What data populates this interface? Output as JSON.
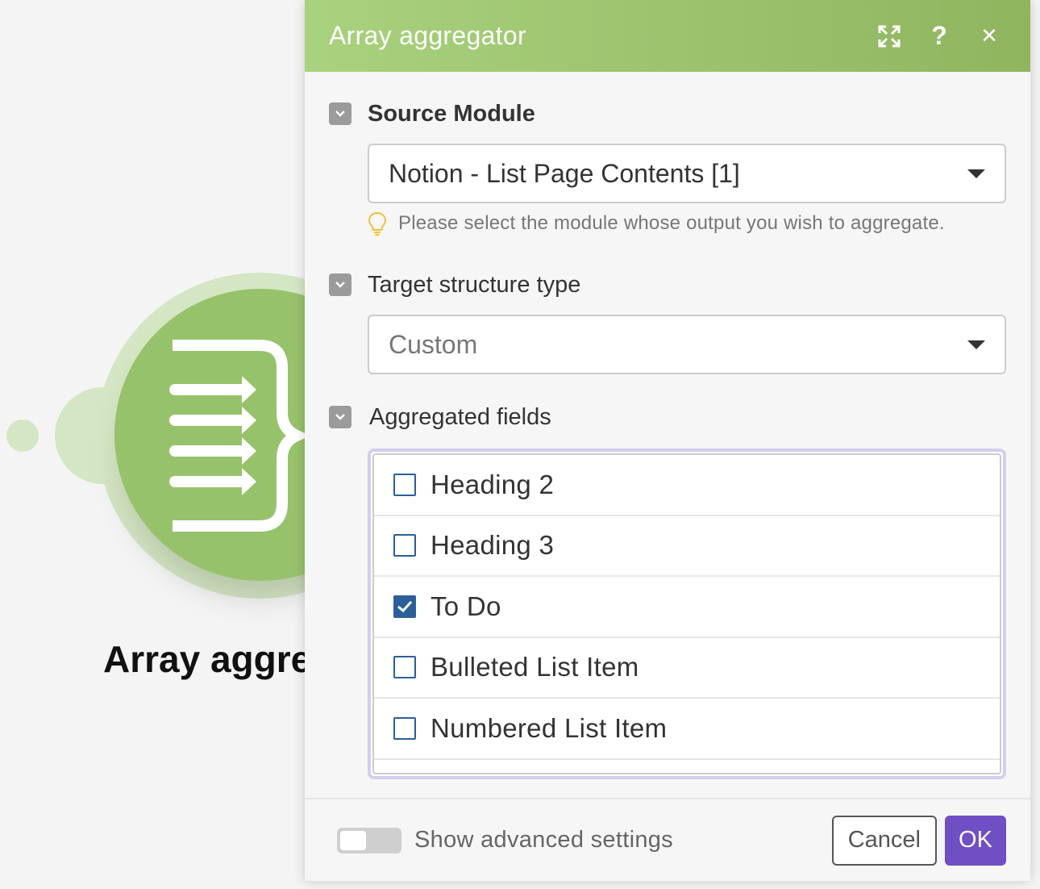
{
  "canvas": {
    "module_label": "Array aggre",
    "module_icon": "array-aggregator-icon"
  },
  "dialog": {
    "title": "Array aggregator",
    "header_icons": [
      "expand-icon",
      "help-icon",
      "close-icon"
    ],
    "help_glyph": "?",
    "close_glyph": "✕",
    "source_module": {
      "label": "Source Module",
      "value": "Notion - List Page Contents [1]",
      "hint": "Please select the module whose output you wish to aggregate."
    },
    "target_structure": {
      "label": "Target structure type",
      "value": "Custom"
    },
    "aggregated_fields": {
      "label": "Aggregated fields",
      "items": [
        {
          "label": "Heading 2",
          "checked": false
        },
        {
          "label": "Heading 3",
          "checked": false
        },
        {
          "label": "To Do",
          "checked": true
        },
        {
          "label": "Bulleted List Item",
          "checked": false
        },
        {
          "label": "Numbered List Item",
          "checked": false
        }
      ]
    },
    "footer": {
      "advanced_label": "Show advanced settings",
      "advanced_on": false,
      "cancel_label": "Cancel",
      "ok_label": "OK"
    }
  },
  "colors": {
    "header_start": "#a9d27e",
    "header_end": "#8fb55f",
    "ok_button": "#6f4fc3",
    "checkbox": "#2c5f9a",
    "module_core": "#97c26c",
    "module_ring": "#d4e6c3"
  }
}
